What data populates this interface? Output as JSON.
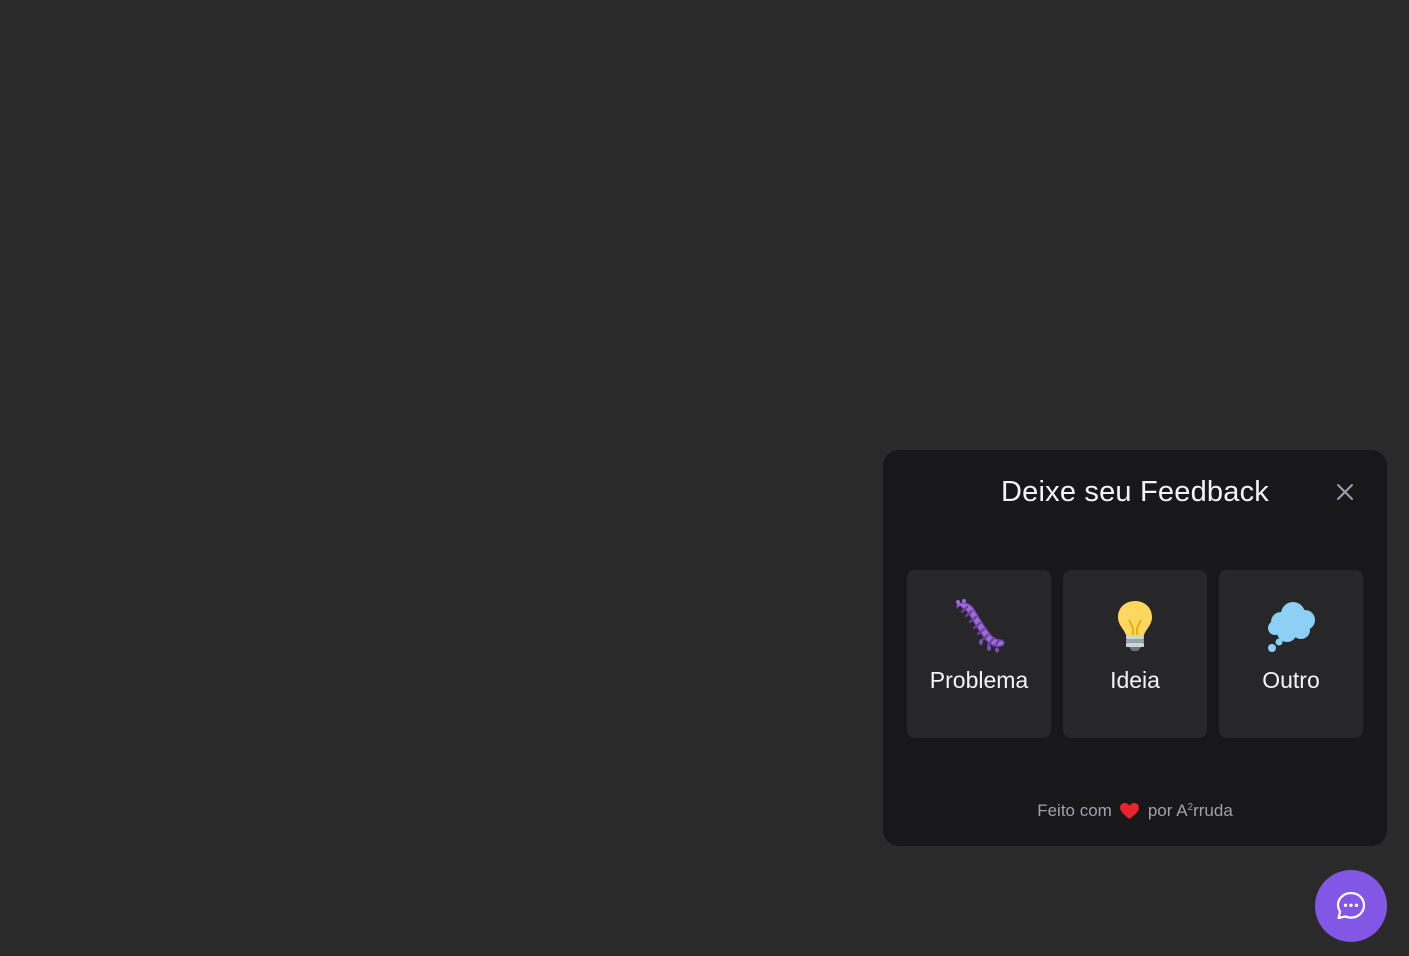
{
  "widget": {
    "title": "Deixe seu Feedback",
    "close_icon": "close-icon",
    "types": [
      {
        "label": "Problema",
        "icon": "bug-icon"
      },
      {
        "label": "Ideia",
        "icon": "lightbulb-icon"
      },
      {
        "label": "Outro",
        "icon": "thought-bubble-icon"
      }
    ],
    "footer": {
      "prefix": "Feito com",
      "icon": "heart-icon",
      "by": "por A",
      "sup": "2",
      "suffix": "rruda"
    }
  },
  "launcher": {
    "icon": "chat-dots-icon"
  },
  "colors": {
    "background": "#2a2a2a",
    "panel": "#18181b",
    "card": "#27272a",
    "accent": "#8257e5",
    "text": "#f4f4f5",
    "muted": "#a1a1aa"
  }
}
